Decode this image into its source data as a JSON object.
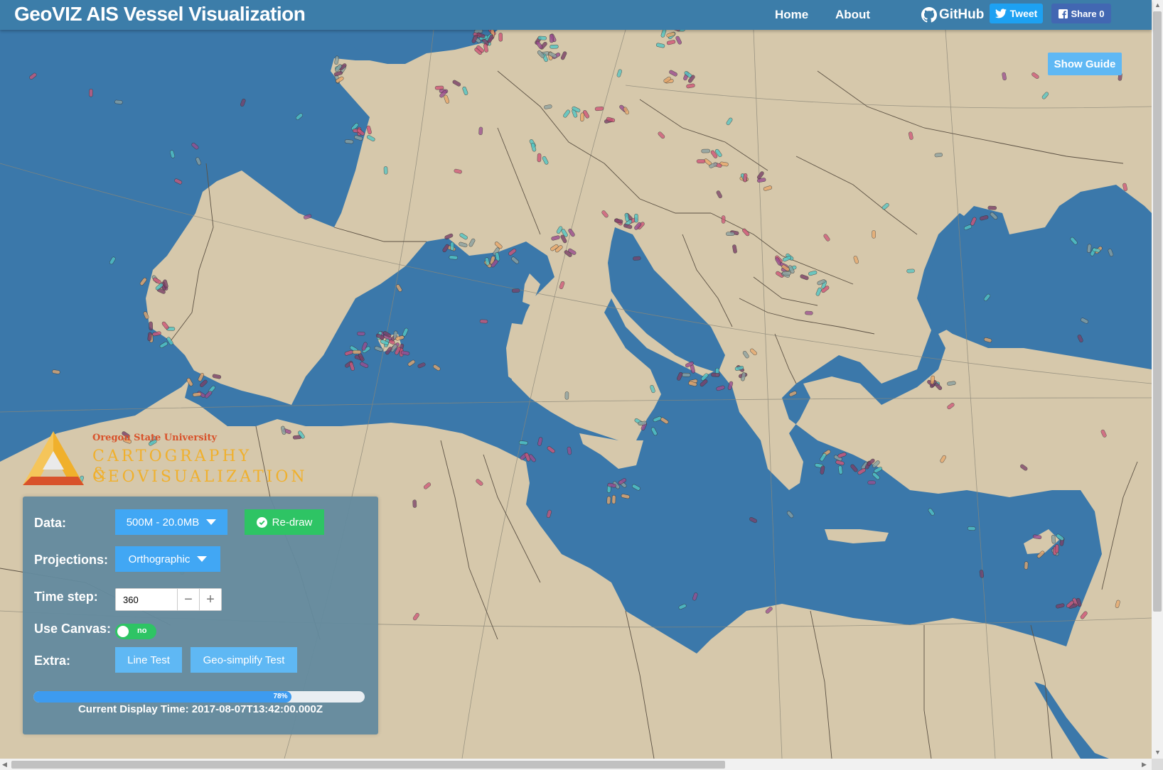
{
  "header": {
    "title": "GeoVIZ AIS Vessel Visualization",
    "nav": {
      "home": "Home",
      "about": "About",
      "github": "GitHub"
    },
    "tweet_label": "Tweet",
    "share_label": "Share 0"
  },
  "guide_button": "Show Guide",
  "logo": {
    "university": "Oregon State University",
    "line1": "CARTOGRAPHY &",
    "line2": "GEOVISUALIZATION"
  },
  "controls": {
    "data_label": "Data:",
    "data_value": "500M - 20.0MB",
    "redraw_label": "Re-draw",
    "projections_label": "Projections:",
    "projection_value": "Orthographic",
    "timestep_label": "Time step:",
    "timestep_value": "360",
    "canvas_label": "Use Canvas:",
    "canvas_toggle_text": "no",
    "canvas_enabled": false,
    "extra_label": "Extra:",
    "line_test_label": "Line Test",
    "geo_simplify_label": "Geo-simplify Test",
    "progress_percent": 78,
    "progress_text": "78%",
    "current_time": "Current Display Time: 2017-08-07T13:42:00.000Z"
  },
  "colors": {
    "ocean": "#3b78aa",
    "land": "#d6c8ab",
    "navbar": "#3c7da9",
    "button_blue": "#41a7f4",
    "button_green": "#2ec464",
    "vessel_colors": [
      "#52c6c5",
      "#9b4c8f",
      "#d05577",
      "#e9a86b",
      "#7a3f67",
      "#8aa1a1"
    ]
  }
}
